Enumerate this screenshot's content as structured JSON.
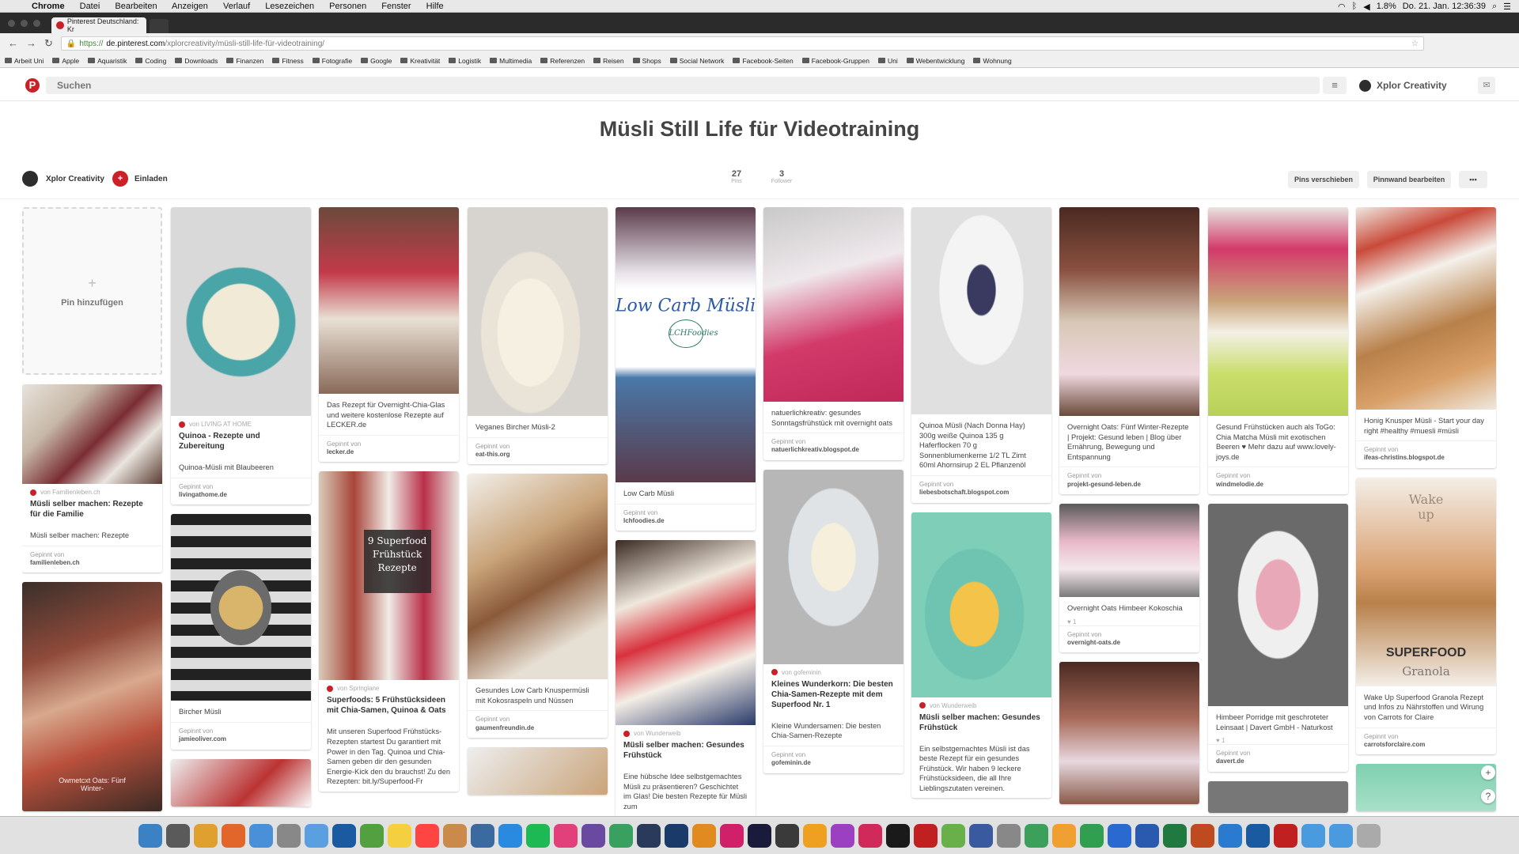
{
  "macos": {
    "apple": "",
    "menu": [
      "Chrome",
      "Datei",
      "Bearbeiten",
      "Anzeigen",
      "Verlauf",
      "Lesezeichen",
      "Personen",
      "Fenster",
      "Hilfe"
    ],
    "battery": "1.8%",
    "clock": "Do. 21. Jan. 12:36:39"
  },
  "browser": {
    "tab_title": "Pinterest Deutschland: Kr",
    "url_scheme": "https://",
    "url_domain": "de.pinterest.com",
    "url_path": "/xplorcreativity/müsli-still-life-für-videotraining/"
  },
  "bookmarks": [
    "Arbeit Uni",
    "Apple",
    "Aquaristik",
    "Coding",
    "Downloads",
    "Finanzen",
    "Fitness",
    "Fotografie",
    "Google",
    "Kreativität",
    "Logistik",
    "Multimedia",
    "Referenzen",
    "Reisen",
    "Shops",
    "Social Network",
    "Facebook-Seiten",
    "Facebook-Gruppen",
    "Uni",
    "Webentwicklung",
    "Wohnung"
  ],
  "header": {
    "logo": "P",
    "search_placeholder": "Suchen",
    "menu_icon": "≡",
    "user_name": "Xplor Creativity",
    "message_icon": "✉"
  },
  "board": {
    "title": "Müsli Still Life für Videotraining",
    "owner": "Xplor Creativity",
    "invite": "Einladen",
    "pins_count": "27",
    "pins_label": "Pins",
    "followers_count": "3",
    "followers_label": "Follower",
    "move_pins": "Pins verschieben",
    "edit_board": "Pinnwand bearbeiten",
    "more": "•••"
  },
  "add_pin": {
    "plus": "+",
    "label": "Pin hinzufügen"
  },
  "pins": {
    "p1": {
      "src": "von Familienleben.ch",
      "heading": "Müsli selber machen: Rezepte für die Familie",
      "cap": "Müsli selber machen: Rezepte",
      "via_label": "Gepinnt von",
      "via": "familienleben.ch"
    },
    "p2": {
      "overlay": "Owmetcxt Oats: Fünf Winter-"
    },
    "p3": {
      "src": "von LIVING AT HOME",
      "heading": "Quinoa - Rezepte und Zubereitung",
      "cap": "Quinoa-Müsli mit Blaubeeren",
      "via_label": "Gepinnt von",
      "via": "livingathome.de"
    },
    "p4": {
      "cap": "Bircher Müsli",
      "via_label": "Gepinnt von",
      "via": "jamieoliver.com"
    },
    "p5": {
      "cap": "Das Rezept für Overnight-Chia-Glas und weitere kostenlose Rezepte auf LECKER.de",
      "via_label": "Gepinnt von",
      "via": "lecker.de"
    },
    "p6": {
      "overlay": "9 Superfood Frühstück Rezepte",
      "src": "von Springlane",
      "heading": "Superfoods: 5 Frühstücksideen mit Chia-Samen, Quinoa & Oats",
      "cap": "Mit unseren Superfood Frühstücks-Rezepten startest Du garantiert mit Power in den Tag. Quinoa und Chia-Samen geben dir den gesunden Energie-Kick den du brauchst! Zu den Rezepten: bit.ly/Superfood-Fr"
    },
    "p7": {
      "cap": "Veganes Bircher Müsli-2",
      "via_label": "Gepinnt von",
      "via": "eat-this.org"
    },
    "p8": {
      "cap": "Gesundes Low Carb Knuspermüsli mit Kokosraspeln und Nüssen",
      "via_label": "Gepinnt von",
      "via": "gaumenfreundin.de"
    },
    "p9": {
      "overlay": "Low Carb Müsli",
      "overlay2": "LCHFoodies",
      "cap": "Low Carb Müsli",
      "via_label": "Gepinnt von",
      "via": "lchfoodies.de"
    },
    "p10": {
      "src": "von Wunderweib",
      "heading": "Müsli selber machen: Gesundes Frühstück",
      "cap": "Eine hübsche Idee selbstgemachtes Müsli zu präsentieren? Geschichtet im Glas! Die besten Rezepte für Müsli zum"
    },
    "p11": {
      "cap": "natuerlichkreativ: gesundes Sonntagsfrühstück mit overnight oats",
      "via_label": "Gepinnt von",
      "via": "natuerlichkreativ.blogspot.de"
    },
    "p12": {
      "src": "von gofeminin",
      "heading": "Kleines Wunderkorn: Die besten Chia-Samen-Rezepte mit dem Superfood Nr. 1",
      "cap": "Kleine Wundersamen: Die besten Chia-Samen-Rezepte",
      "via_label": "Gepinnt von",
      "via": "gofeminin.de"
    },
    "p13": {
      "cap": "Quinoa Müsli (Nach Donna Hay) 300g weiße Quinoa 135 g Haferflocken 70 g Sonnenblumenkerne 1/2 TL Zimt 60ml Ahornsirup 2 EL Pflanzenöl",
      "via_label": "Gepinnt von",
      "via": "liebesbotschaft.blogspot.com"
    },
    "p14": {
      "src": "von Wunderweib",
      "heading": "Müsli selber machen: Gesundes Frühstück",
      "cap": "Ein selbstgemachtes Müsli ist das beste Rezept für ein gesundes Frühstück. Wir haben 9 leckere Frühstücksideen, die all Ihre Lieblingszutaten vereinen."
    },
    "p15": {
      "cap": "Overnight Oats: Fünf Winter-Rezepte | Projekt: Gesund leben | Blog über Ernährung, Bewegung und Entspannung",
      "via_label": "Gepinnt von",
      "via": "projekt-gesund-leben.de"
    },
    "p16": {
      "cap": "Overnight Oats Himbeer Kokoschia",
      "likes": "♥ 1",
      "via_label": "Gepinnt von",
      "via": "overnight-oats.de"
    },
    "p17": {
      "cap": "Gesund Frühstücken auch als ToGo: Chia Matcha Müsli mit exotischen Beeren ♥ Mehr dazu auf www.lovely-joys.de",
      "via_label": "Gepinnt von",
      "via": "windmelodie.de"
    },
    "p18": {
      "cap": "Himbeer Porridge mit geschroteter Leinsaat | Davert GmbH - Naturkost",
      "likes": "♥ 1",
      "via_label": "Gepinnt von",
      "via": "davert.de"
    },
    "p19": {
      "cap": "Honig Knusper Müsli - Start your day right #healthy #muesli #müsli",
      "via_label": "Gepinnt von",
      "via": "ifeas-christins.blogspot.de"
    },
    "p20": {
      "overlay": "Wake up",
      "overlay2": "SUPERFOOD",
      "overlay3": "Granola",
      "cap": "Wake Up Superfood Granola Rezept und Infos zu Nährstoffen und Wirung von Carrots for Claire",
      "via_label": "Gepinnt von",
      "via": "carrotsforclaire.com"
    }
  },
  "fab": {
    "plus": "+",
    "help": "?"
  },
  "dock_icons": [
    "finder",
    "launchpad",
    "chrome",
    "firefox",
    "mail",
    "script",
    "preview",
    "1password",
    "evernote",
    "notes",
    "calendar",
    "books",
    "network",
    "appstore",
    "spotify",
    "itunes",
    "imovie",
    "mapper",
    "lightroom",
    "photoshop",
    "illustrator",
    "indesign",
    "c4d",
    "finalcut",
    "sketch",
    "color",
    "pins",
    "terminal",
    "filezilla",
    "leaf",
    "dictionary",
    "files",
    "maps",
    "pages",
    "numbers",
    "keynote",
    "word",
    "excel",
    "powerpoint",
    "browser",
    "1pw2",
    "acrobat",
    "folder1",
    "folder2",
    "trash"
  ]
}
